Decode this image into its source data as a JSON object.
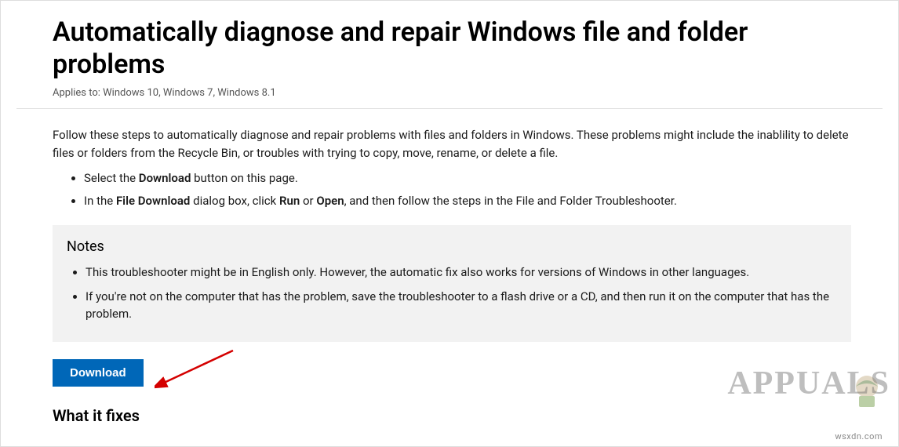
{
  "header": {
    "title": "Automatically diagnose and repair Windows file and folder problems",
    "applies_to": "Applies to: Windows 10, Windows 7, Windows 8.1"
  },
  "intro": "Follow these steps to automatically diagnose and repair problems with files and folders in Windows. These problems might include the inablility to delete files or folders from the Recycle Bin, or troubles with trying to copy, move, rename, or delete a file.",
  "steps": {
    "item1": {
      "t1": "Select the ",
      "b1": "Download",
      "t2": " button on this page."
    },
    "item2": {
      "t1": "In the ",
      "b1": "File Download",
      "t2": " dialog box, click ",
      "b2": "Run",
      "t3": " or ",
      "b3": "Open",
      "t4": ", and then follow the steps in the File and Folder Troubleshooter."
    }
  },
  "notes": {
    "heading": "Notes",
    "item1": "This troubleshooter might be in English only. However, the automatic fix also works for versions of Windows in other languages.",
    "item2": "If you're not on the computer that has the problem, save the troubleshooter to a flash drive or a CD, and then run it on the computer that has the problem."
  },
  "download_label": "Download",
  "section_heading": "What it fixes",
  "watermark": {
    "brand": "APPUALS",
    "site": "wsxdn.com"
  },
  "colors": {
    "accent": "#0067b8",
    "notes_bg": "#f2f2f2"
  }
}
